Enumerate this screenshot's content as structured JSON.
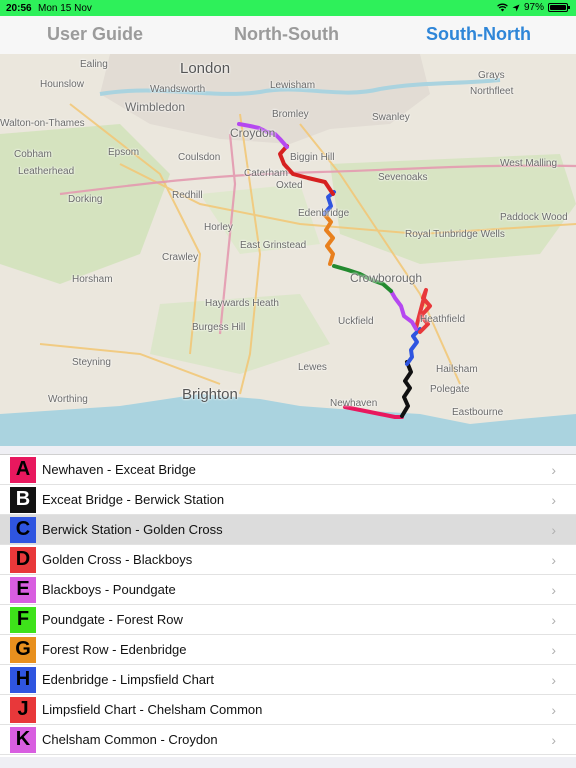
{
  "status_bar": {
    "time": "20:56",
    "date": "Mon 15 Nov",
    "battery": "97%",
    "battery_level": 0.97,
    "icons": [
      "wifi-icon",
      "location-arrow-icon",
      "battery-icon"
    ]
  },
  "tabs": [
    {
      "label": "User Guide",
      "active": false
    },
    {
      "label": "North-South",
      "active": false
    },
    {
      "label": "South-North",
      "active": true
    }
  ],
  "colors": {
    "active_tab": "#2f86d8",
    "inactive_tab": "#9b9b9b",
    "status_bar": "#2ef05a",
    "selected_row": "#dcdcdc"
  },
  "map": {
    "places": [
      {
        "name": "Ealing"
      },
      {
        "name": "London"
      },
      {
        "name": "Grays"
      },
      {
        "name": "Hounslow"
      },
      {
        "name": "Wandsworth"
      },
      {
        "name": "Lewisham"
      },
      {
        "name": "Northfleet"
      },
      {
        "name": "Wimbledon"
      },
      {
        "name": "Bromley"
      },
      {
        "name": "Swanley"
      },
      {
        "name": "Walton-on-Thames"
      },
      {
        "name": "Croydon"
      },
      {
        "name": "Cobham"
      },
      {
        "name": "Epsom"
      },
      {
        "name": "Coulsdon"
      },
      {
        "name": "Biggin Hill"
      },
      {
        "name": "Leatherhead"
      },
      {
        "name": "Caterham"
      },
      {
        "name": "Sevenoaks"
      },
      {
        "name": "West Malling"
      },
      {
        "name": "Dorking"
      },
      {
        "name": "Redhill"
      },
      {
        "name": "Oxted"
      },
      {
        "name": "Edenbridge"
      },
      {
        "name": "Paddock Wood"
      },
      {
        "name": "Horley"
      },
      {
        "name": "Royal Tunbridge Wells"
      },
      {
        "name": "East Grinstead"
      },
      {
        "name": "Crawley"
      },
      {
        "name": "Crowborough"
      },
      {
        "name": "Horsham"
      },
      {
        "name": "Haywards Heath"
      },
      {
        "name": "Uckfield"
      },
      {
        "name": "Heathfield"
      },
      {
        "name": "Burgess Hill"
      },
      {
        "name": "Steyning"
      },
      {
        "name": "Lewes"
      },
      {
        "name": "Hailsham"
      },
      {
        "name": "Polegate"
      },
      {
        "name": "Worthing"
      },
      {
        "name": "Brighton"
      },
      {
        "name": "Newhaven"
      },
      {
        "name": "Eastbourne"
      }
    ]
  },
  "sections": [
    {
      "letter": "A",
      "label": "Newhaven - Exceat Bridge",
      "color": "#e8185e",
      "selected": false
    },
    {
      "letter": "B",
      "label": "Exceat Bridge - Berwick Station",
      "color": "#111111",
      "selected": false
    },
    {
      "letter": "C",
      "label": "Berwick Station - Golden Cross",
      "color": "#2f55e0",
      "selected": true
    },
    {
      "letter": "D",
      "label": "Golden Cross - Blackboys",
      "color": "#e8383a",
      "selected": false
    },
    {
      "letter": "E",
      "label": "Blackboys - Poundgate",
      "color": "#d85ee0",
      "selected": false
    },
    {
      "letter": "F",
      "label": "Poundgate - Forest Row",
      "color": "#3ee21a",
      "selected": false
    },
    {
      "letter": "G",
      "label": "Forest Row - Edenbridge",
      "color": "#e8901e",
      "selected": false
    },
    {
      "letter": "H",
      "label": "Edenbridge - Limpsfield Chart",
      "color": "#2f55e0",
      "selected": false
    },
    {
      "letter": "J",
      "label": "Limpsfield Chart - Chelsham Common",
      "color": "#e8383a",
      "selected": false
    },
    {
      "letter": "K",
      "label": "Chelsham Common - Croydon",
      "color": "#d85ee0",
      "selected": false
    }
  ]
}
